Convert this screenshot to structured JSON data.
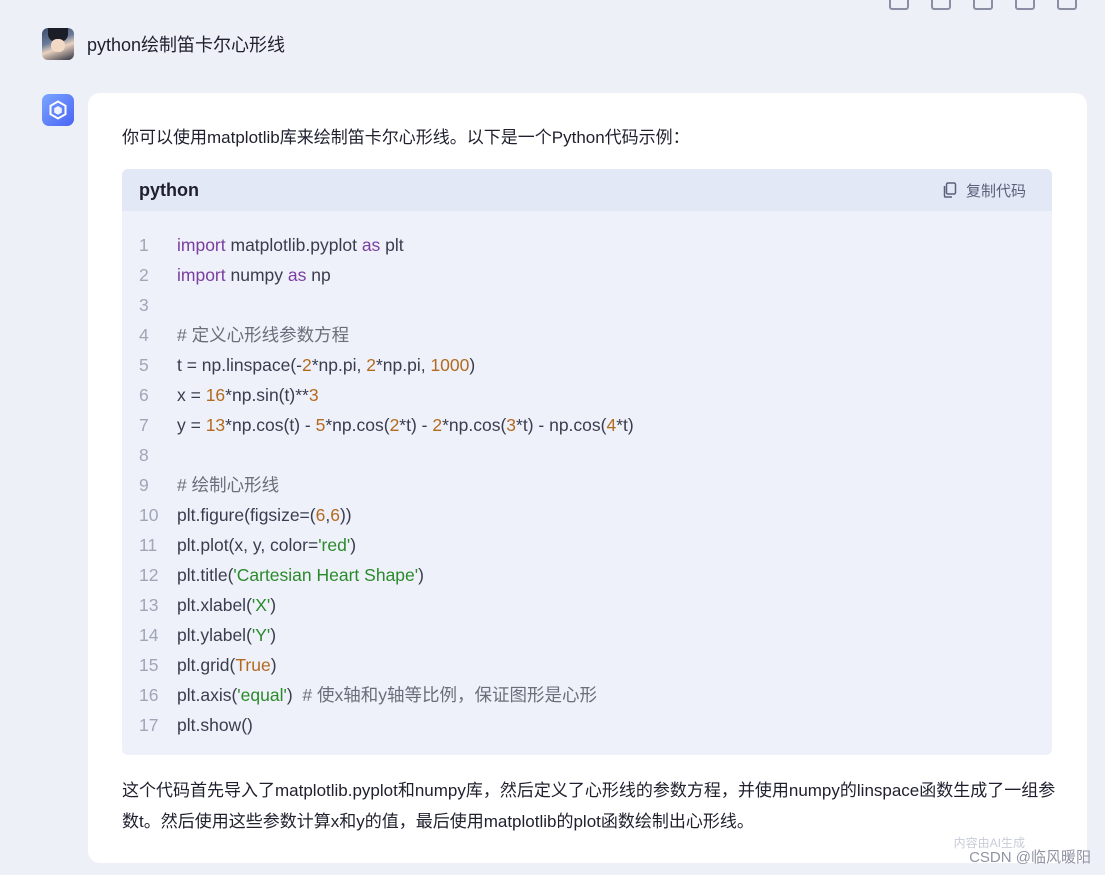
{
  "user": {
    "question": "python绘制笛卡尔心形线"
  },
  "answer": {
    "intro": "你可以使用matplotlib库来绘制笛卡尔心形线。以下是一个Python代码示例：",
    "code_lang": "python",
    "copy_label": "复制代码",
    "code_lines": [
      {
        "n": "1",
        "html": "<span class=\"kw\">import</span> matplotlib.pyplot <span class=\"kw\">as</span> plt"
      },
      {
        "n": "2",
        "html": "<span class=\"kw\">import</span> numpy <span class=\"kw\">as</span> np"
      },
      {
        "n": "3",
        "html": ""
      },
      {
        "n": "4",
        "html": "<span class=\"cmt\"># 定义心形线参数方程</span>"
      },
      {
        "n": "5",
        "html": "t = np.linspace(-<span class=\"num\">2</span>*np.pi, <span class=\"num\">2</span>*np.pi, <span class=\"num\">1000</span>)"
      },
      {
        "n": "6",
        "html": "x = <span class=\"num\">16</span>*np.sin(t)**<span class=\"num\">3</span>"
      },
      {
        "n": "7",
        "html": "y = <span class=\"num\">13</span>*np.cos(t) - <span class=\"num\">5</span>*np.cos(<span class=\"num\">2</span>*t) - <span class=\"num\">2</span>*np.cos(<span class=\"num\">3</span>*t) - np.cos(<span class=\"num\">4</span>*t)"
      },
      {
        "n": "8",
        "html": ""
      },
      {
        "n": "9",
        "html": "<span class=\"cmt\"># 绘制心形线</span>"
      },
      {
        "n": "10",
        "html": "plt.figure(figsize=(<span class=\"num\">6</span>,<span class=\"num\">6</span>))"
      },
      {
        "n": "11",
        "html": "plt.plot(x, y, color=<span class=\"str\">'red'</span>)"
      },
      {
        "n": "12",
        "html": "plt.title(<span class=\"str\">'Cartesian Heart Shape'</span>)"
      },
      {
        "n": "13",
        "html": "plt.xlabel(<span class=\"str\">'X'</span>)"
      },
      {
        "n": "14",
        "html": "plt.ylabel(<span class=\"str\">'Y'</span>)"
      },
      {
        "n": "15",
        "html": "plt.grid(<span class=\"num\">True</span>)"
      },
      {
        "n": "16",
        "html": "plt.axis(<span class=\"str\">'equal'</span>)  <span class=\"cmt\"># 使x轴和y轴等比例，保证图形是心形</span>"
      },
      {
        "n": "17",
        "html": "plt.show()"
      }
    ],
    "summary": "这个代码首先导入了matplotlib.pyplot和numpy库，然后定义了心形线的参数方程，并使用numpy的linspace函数生成了一组参数t。然后使用这些参数计算x和y的值，最后使用matplotlib的plot函数绘制出心形线。"
  },
  "watermark": "CSDN @临风暖阳",
  "watermark_faint": "内容由AI生成"
}
